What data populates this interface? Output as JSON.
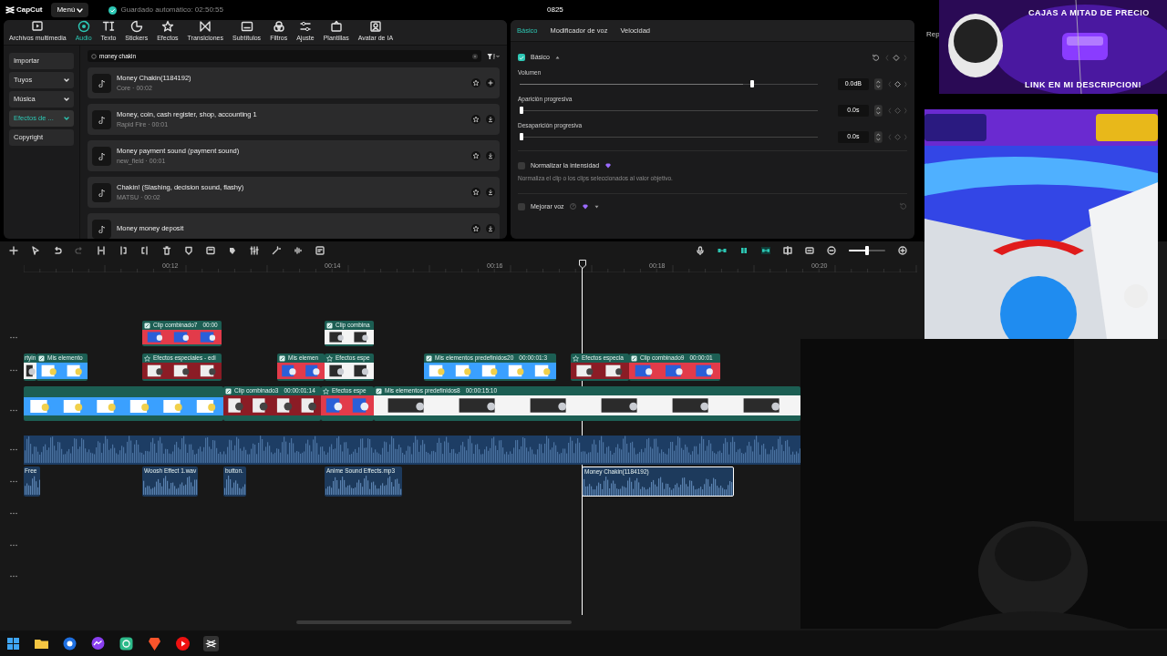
{
  "app": {
    "logo": "CapCut",
    "menu": "Menú",
    "autosave": "Guardado automático: 02:50:55",
    "project_title": "0825",
    "cut_tab": "Rep"
  },
  "media_tabs": [
    {
      "label": "Archivos multimedia",
      "selected": false
    },
    {
      "label": "Audio",
      "selected": true
    },
    {
      "label": "Texto",
      "selected": false
    },
    {
      "label": "Stickers",
      "selected": false
    },
    {
      "label": "Efectos",
      "selected": false
    },
    {
      "label": "Transiciones",
      "selected": false
    },
    {
      "label": "Subtítulos",
      "selected": false
    },
    {
      "label": "Filtros",
      "selected": false
    },
    {
      "label": "Ajuste",
      "selected": false
    },
    {
      "label": "Plantillas",
      "selected": false
    },
    {
      "label": "Avatar de IA",
      "selected": false
    }
  ],
  "side_nav": [
    {
      "label": "Importar",
      "expandable": false,
      "selected": false
    },
    {
      "label": "Tuyos",
      "expandable": true,
      "selected": false
    },
    {
      "label": "Música",
      "expandable": true,
      "selected": false
    },
    {
      "label": "Efectos de ...",
      "expandable": true,
      "selected": true
    },
    {
      "label": "Copyright",
      "expandable": false,
      "selected": false
    }
  ],
  "search": {
    "value": "money chakin"
  },
  "sounds": [
    {
      "title": "Money Chakin(1184192)",
      "meta": "Core · 00:02",
      "kind": "add"
    },
    {
      "title": "Money, coin, cash register, shop, accounting 1",
      "meta": "Rapid Fire · 00:01",
      "kind": "download"
    },
    {
      "title": "Money payment sound (payment sound)",
      "meta": "new_field · 00:01",
      "kind": "download"
    },
    {
      "title": "Chakin! (Slashing, decision sound, flashy)",
      "meta": "MATSU · 00:02",
      "kind": "download"
    },
    {
      "title": "Money money deposit",
      "kind": "download"
    }
  ],
  "settings": {
    "tabs": [
      {
        "label": "Básico",
        "selected": true
      },
      {
        "label": "Modificador de voz",
        "selected": false
      },
      {
        "label": "Velocidad",
        "selected": false
      }
    ],
    "section": {
      "label": "Básico",
      "checked": true
    },
    "sliders": [
      {
        "label": "Volumen",
        "level": 0.75,
        "reading": "0.0dB",
        "keyframe_active": true
      },
      {
        "label": "Aparición progresiva",
        "level": 0,
        "reading": "0.0s",
        "keyframe_active": false
      },
      {
        "label": "Desaparición progresiva",
        "level": 0,
        "reading": "0.0s",
        "keyframe_active": false
      }
    ],
    "normalize": {
      "label": "Normalizar la intensidad",
      "checked": false,
      "premium": true,
      "description": "Normaliza el clip o los clips seleccionados al valor objetivo."
    },
    "enhance": {
      "label": "Mejorar voz",
      "checked": false,
      "premium": true
    }
  },
  "timeline": {
    "zoom": {
      "level": 0.5
    },
    "ruler": [
      "00:12",
      "00:14",
      "00:16",
      "00:18",
      "00:20"
    ],
    "tracks": [
      {
        "kind": "overlay",
        "clips": [
          {
            "kind": "combined",
            "title": "Clip combinado7",
            "duration": "00:00"
          },
          {
            "kind": "combined",
            "title": "Clip combina"
          }
        ]
      },
      {
        "kind": "overlay",
        "clips": [
          {
            "kind": "plain",
            "title": "rtyin"
          },
          {
            "kind": "combined",
            "title": "Mis elemento"
          },
          {
            "kind": "effect",
            "title": "Efectos especiales - edi"
          },
          {
            "kind": "combined",
            "title": "Mis elemen"
          },
          {
            "kind": "effect",
            "title": "Efectos espe"
          },
          {
            "kind": "combined",
            "title": "Mis elementos predefinidos20",
            "duration": "00:00:01:3"
          },
          {
            "kind": "effect",
            "title": "Efectos especia"
          },
          {
            "kind": "combined",
            "title": "Clip combinado9",
            "duration": "00:00:01"
          }
        ]
      },
      {
        "kind": "main",
        "clips": [
          {
            "kind": "video"
          },
          {
            "kind": "combined",
            "title": "Clip combinado3",
            "duration": "00:00:01:14"
          },
          {
            "kind": "effect",
            "title": "Efectos espe"
          },
          {
            "kind": "combined",
            "title": "Mis elementos predefinidos8",
            "duration": "00:00:15:10"
          }
        ]
      },
      {
        "kind": "bed",
        "clips": [
          {
            "kind": "audio"
          }
        ]
      },
      {
        "kind": "audio",
        "clips": [
          {
            "kind": "audio",
            "title": "Free",
            "selected": false
          },
          {
            "kind": "audio",
            "title": "Woosh Effect 1.wav",
            "selected": false
          },
          {
            "kind": "audio",
            "title": "button.",
            "selected": false
          },
          {
            "kind": "audio",
            "title": "Anime Sound Effects.mp3",
            "selected": false
          },
          {
            "kind": "audio",
            "title": "Money Chakin(1184192)",
            "selected": true
          }
        ]
      }
    ]
  },
  "banner": {
    "headline": "CAJAS A MITAD DE PRECIO",
    "footer": "LINK EN MI DESCRIPCION!"
  }
}
